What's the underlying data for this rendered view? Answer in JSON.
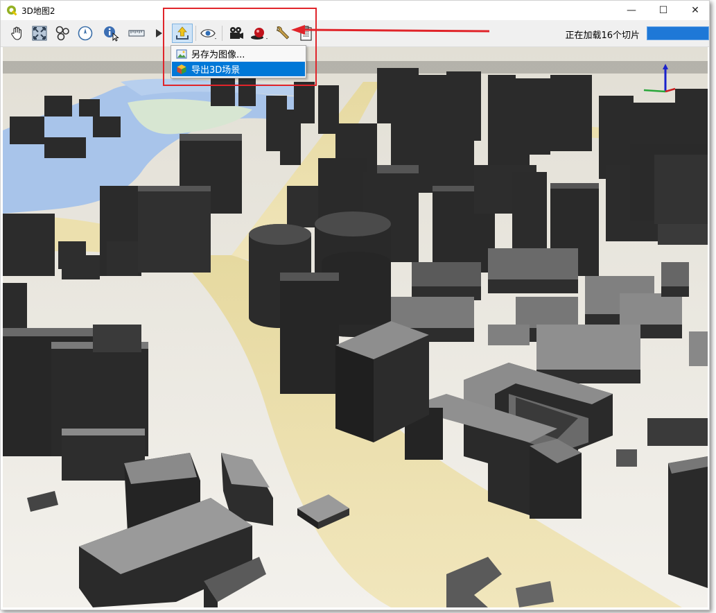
{
  "window": {
    "title": "3D地图2",
    "minimize": "—",
    "maximize": "☐",
    "close": "✕"
  },
  "toolbar": {
    "items": [
      {
        "name": "pan-icon"
      },
      {
        "name": "zoom-full-icon"
      },
      {
        "name": "identify-objects-icon"
      },
      {
        "name": "compass-icon"
      },
      {
        "name": "identify-info-icon"
      },
      {
        "name": "measure-icon"
      },
      {
        "name": "play-icon"
      },
      {
        "name": "export-icon"
      },
      {
        "name": "eye-icon"
      },
      {
        "name": "camera-icon"
      },
      {
        "name": "shadow-icon"
      },
      {
        "name": "wrench-icon"
      },
      {
        "name": "clipboard-icon"
      }
    ],
    "status_text": "正在加载16个切片",
    "progress": 1.0
  },
  "menu": {
    "items": [
      {
        "label": "另存为图像...",
        "icon": "image-save-icon"
      },
      {
        "label": "导出3D场景",
        "icon": "cube-export-icon"
      }
    ]
  },
  "colors": {
    "water": "#a8c4ea",
    "road": "#ecdfa9",
    "building": "#2d2d2d",
    "highlight": "#e0242a",
    "progress": "#1e78d7"
  }
}
